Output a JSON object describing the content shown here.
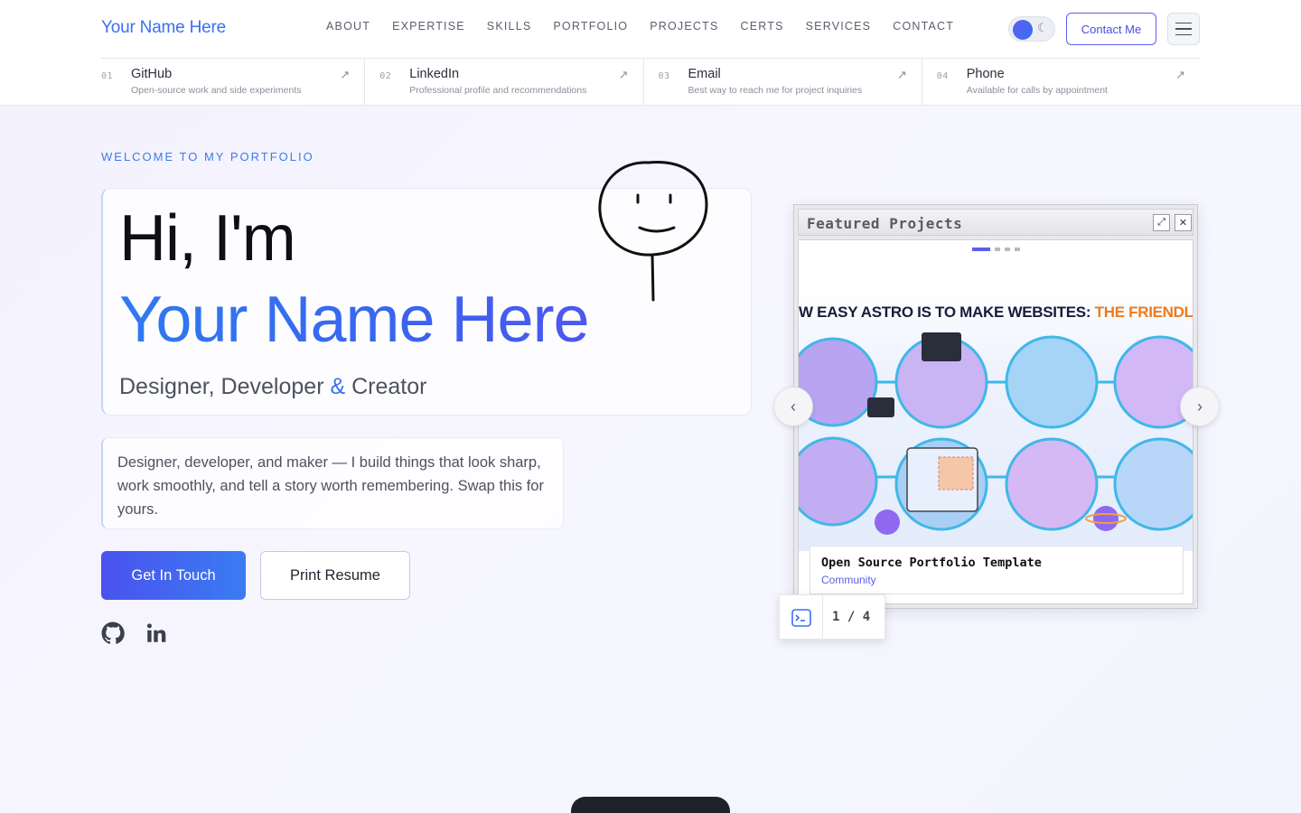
{
  "header": {
    "brand": "Your Name Here",
    "nav": [
      "ABOUT",
      "EXPERTISE",
      "SKILLS",
      "PORTFOLIO",
      "PROJECTS",
      "CERTS",
      "SERVICES",
      "CONTACT"
    ],
    "contact_button": "Contact Me"
  },
  "links": [
    {
      "num": "01",
      "title": "GitHub",
      "desc": "Open-source work and side experiments"
    },
    {
      "num": "02",
      "title": "LinkedIn",
      "desc": "Professional profile and recommendations"
    },
    {
      "num": "03",
      "title": "Email",
      "desc": "Best way to reach me for project inquiries"
    },
    {
      "num": "04",
      "title": "Phone",
      "desc": "Available for calls by appointment"
    }
  ],
  "hero": {
    "eyebrow": "WELCOME TO MY PORTFOLIO",
    "greeting": "Hi, I'm",
    "name": "Your Name Here",
    "tagline_a": "Designer, Developer ",
    "tagline_amp": "&",
    "tagline_b": " Creator",
    "bio": "Designer, developer, and maker — I build things that look sharp, work smoothly, and tell a story worth remembering. Swap this for yours.",
    "primary_button": "Get In Touch",
    "secondary_button": "Print Resume"
  },
  "featured": {
    "window_title": "Featured Projects",
    "slide_headline_a": "W EASY ASTRO IS TO MAKE WEBSITES: ",
    "slide_headline_b": "THE FRIENDLY ASTRO GU",
    "caption_title": "Open Source Portfolio Template",
    "caption_sub": "Community",
    "counter": "1 / 4",
    "active_slide": 1,
    "total_slides": 4
  },
  "colors": {
    "accent": "#3b6ef5",
    "accent_purple": "#5b5ef0"
  },
  "icons": {
    "github": "github-icon",
    "linkedin": "linkedin-icon",
    "moon": "moon-icon",
    "menu": "menu-icon",
    "terminal": "terminal-icon"
  }
}
